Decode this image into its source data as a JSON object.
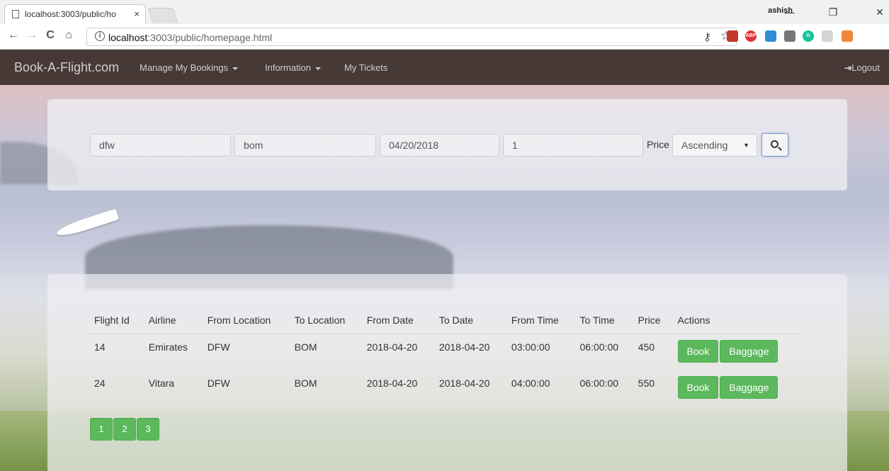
{
  "browser": {
    "tab_title": "localhost:3003/public/ho",
    "tab_close": "×",
    "user_name": "ashish",
    "win_minimize": "—",
    "win_restore": "❐",
    "win_close": "✕",
    "back_icon": "←",
    "forward_icon": "→",
    "reload_icon": "C",
    "home_icon": "⌂",
    "url_host": "localhost",
    "url_path": ":3003/public/homepage.html",
    "key_icon": "⚷",
    "star_icon": "☆",
    "extensions": [
      {
        "name": "bookmark-ext",
        "color": "#c0392b",
        "text": ""
      },
      {
        "name": "adblock-ext",
        "color": "#e0343a",
        "text": "ABP"
      },
      {
        "name": "screen-ext",
        "color": "#2e8fd8",
        "text": ""
      },
      {
        "name": "square-ext",
        "color": "#777777",
        "text": ""
      },
      {
        "name": "grammarly-ext",
        "color": "#15c39a",
        "text": "G"
      },
      {
        "name": "link-ext",
        "color": "#d4d4d4",
        "text": ""
      },
      {
        "name": "color-ext",
        "color": "#f0883a",
        "text": ""
      }
    ]
  },
  "navbar": {
    "brand": "Book-A-Flight.com",
    "links": [
      "Manage My Bookings",
      "Information",
      "My Tickets"
    ],
    "logout_icon": "⇥",
    "logout": "Logout"
  },
  "search": {
    "from": "dfw",
    "to": "bom",
    "date": "04/20/2018",
    "passengers": "1",
    "price_label": "Price",
    "sort": "Ascending",
    "sort_arrow": "▼"
  },
  "results": {
    "headers": [
      "Flight Id",
      "Airline",
      "From Location",
      "To Location",
      "From Date",
      "To Date",
      "From Time",
      "To Time",
      "Price",
      "Actions"
    ],
    "rows": [
      {
        "cells": [
          "14",
          "Emirates",
          "DFW",
          "BOM",
          "2018-04-20",
          "2018-04-20",
          "03:00:00",
          "06:00:00",
          "450"
        ],
        "book": "Book",
        "baggage": "Baggage"
      },
      {
        "cells": [
          "24",
          "Vitara",
          "DFW",
          "BOM",
          "2018-04-20",
          "2018-04-20",
          "04:00:00",
          "06:00:00",
          "550"
        ],
        "book": "Book",
        "baggage": "Baggage"
      }
    ],
    "pages": [
      "1",
      "2",
      "3"
    ]
  }
}
